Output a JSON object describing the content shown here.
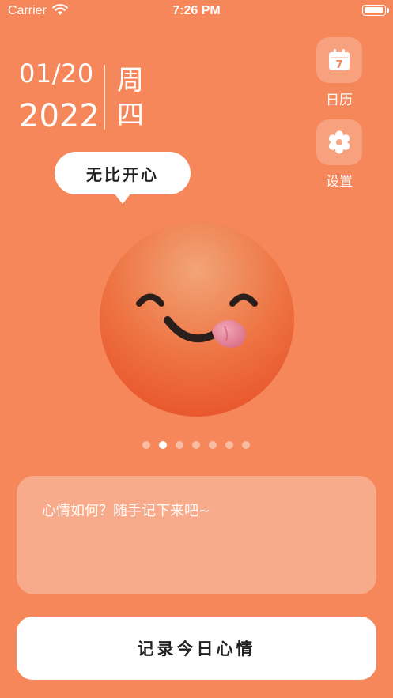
{
  "status_bar": {
    "carrier": "Carrier",
    "time": "7:26 PM"
  },
  "date": {
    "month_day": "01/20",
    "year": "2022",
    "weekday": "周四"
  },
  "side_menu": {
    "calendar": {
      "label": "日历",
      "icon": "calendar-icon",
      "day_number": "7"
    },
    "settings": {
      "label": "设置",
      "icon": "gear-icon"
    }
  },
  "mood": {
    "label": "无比开心",
    "emoji": "face-savoring-food",
    "page_count": 7,
    "current_page": 2
  },
  "note": {
    "placeholder": "心情如何？随手记下来吧~"
  },
  "submit": {
    "label": "记录今日心情"
  },
  "colors": {
    "background": "#F5875A",
    "emoji_top": "#F2A478",
    "emoji_bottom": "#E8532A"
  }
}
